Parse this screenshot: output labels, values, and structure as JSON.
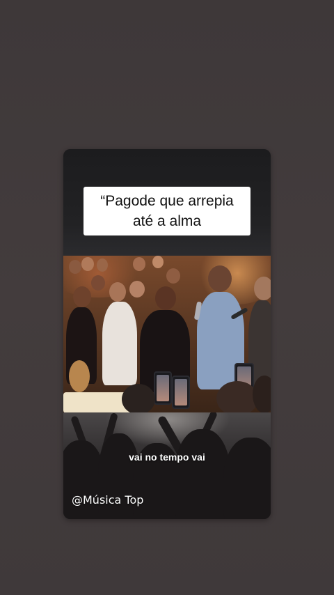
{
  "story": {
    "caption_line_1": "“Pagode que arrepia",
    "caption_line_2": "até a alma",
    "lyric": "vai no tempo vai",
    "watermark": "@Música Top"
  },
  "colors": {
    "background": "#413b3c",
    "card": "#1f1f21",
    "caption_box": "#ffffff",
    "caption_text": "#111111",
    "lyric_text": "#ffffff"
  }
}
